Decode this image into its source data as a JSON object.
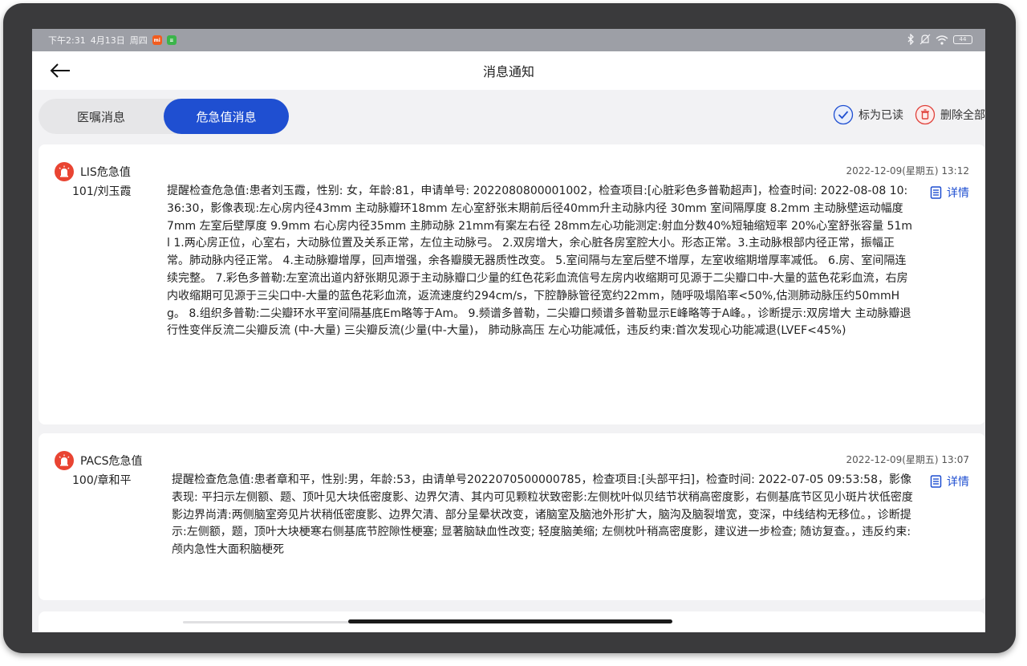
{
  "status_bar": {
    "time": "下午2:31",
    "date": "4月13日",
    "weekday": "周四",
    "app_badges": [
      {
        "label": "mi",
        "color": "#f25c1e"
      },
      {
        "label": "≡",
        "color": "#3bb54a"
      }
    ],
    "battery": "44",
    "icons": [
      "bluetooth-icon",
      "mute-icon",
      "wifi-icon",
      "battery-icon"
    ]
  },
  "header": {
    "title": "消息通知",
    "back_icon": "back-arrow-icon"
  },
  "tabs": [
    {
      "label": "医嘱消息",
      "active": false
    },
    {
      "label": "危急值消息",
      "active": true
    }
  ],
  "actions": {
    "mark_read": "标为已读",
    "delete_all": "删除全部"
  },
  "messages": [
    {
      "type": "LIS危急值",
      "time": "2022-12-09(星期五) 13:12",
      "patient": "101/刘玉霞",
      "detail_label": "详情",
      "content": "提醒检查危急值:患者刘玉霞，性别: 女，年龄:81，申请单号: 2022080800001002，检查项目:[心脏彩色多普勒超声]，检查时间: 2022-08-08 10:36:30，影像表现:左心房内径43mm 主动脉瓣环18mm 左心室舒张末期前后径40mm升主动脉内径 30mm 室间隔厚度 8.2mm 主动脉壁运动幅度 7mm 左室后壁厚度 9.9mm 右心房内径35mm 主肺动脉 21mm有案左右径 28mm左心功能测定:射血分数40%短轴缩短率 20%心室舒张容量 51ml 1.两心房正位，心室右，大动脉位置及关系正常，左位主动脉弓。 2.双房增大，余心脏各房室腔大小。形态正常。3.主动脉根部内径正常，振幅正常。肺动脉内径正常。 4.主动脉瓣增厚，回声增强，余各瓣膜无器质性改变。 5.室间隔与左室后壁不增厚，左室收缩期增厚率减低。 6.房、室间隔连续完整。 7.彩色多普勒:左室流出道内舒张期见源于主动脉瓣口少量的红色花彩血流信号左房内收缩期可见源于二尖瓣口中-大量的蓝色花彩血流，右房内收缩期可见源于三尖口中-大量的蓝色花彩血流，返流速度约294cm/s，下腔静脉管径宽约22mm，随呼吸塌陷率<50%,估测肺动脉压约50mmHg。 8.组织多普勒:二尖瓣环水平室间隔基底Em略等于Am。 9.频谱多普勒，二尖瓣口频谱多普勒显示E峰略等于A峰。，诊断提示:双房增大 主动脉瓣退行性变伴反流二尖瓣反流 (中-大量) 三尖瓣反流(少量(中-大量)， 肺动脉高压 左心功能减低，违反约束:首次发现心功能减退(LVEF<45%)"
    },
    {
      "type": "PACS危急值",
      "time": "2022-12-09(星期五) 13:07",
      "patient": "100/章和平",
      "detail_label": "详情",
      "content": "提醒检查危急值:患者章和平，性别:男，年龄:53，由请单号2022070500000785，检查项目:[头部平扫]，检查时间: 2022-07-05 09:53:58，影像表现: 平扫示左侧额、题、顶叶见大块低密度影、边界欠清、其内可见颗粒状致密影:左侧枕叶似贝结节状稍高密度影，右侧基底节区见小斑片状低密度影边界尚清:两侧脑室旁见片状稍低密度影、边界欠清、部分呈晕状改变，诸脑室及脑池外形扩大，脑沟及脑裂增宽，变深，中线结构无移位。，诊断提示:左侧额，题，顶叶大块梗寒右侧基底节腔隙性梗塞; 显著脑缺血性改变; 轻度脑美缩; 左侧枕叶稍高密度影，建议进一步检查; 随访复查。，违反约束:颅内急性大面积脑梗死"
    }
  ],
  "colors": {
    "accent": "#1f4fd1",
    "alarm": "#e94432",
    "delete": "#e0413a",
    "background": "#f2f2f4"
  }
}
